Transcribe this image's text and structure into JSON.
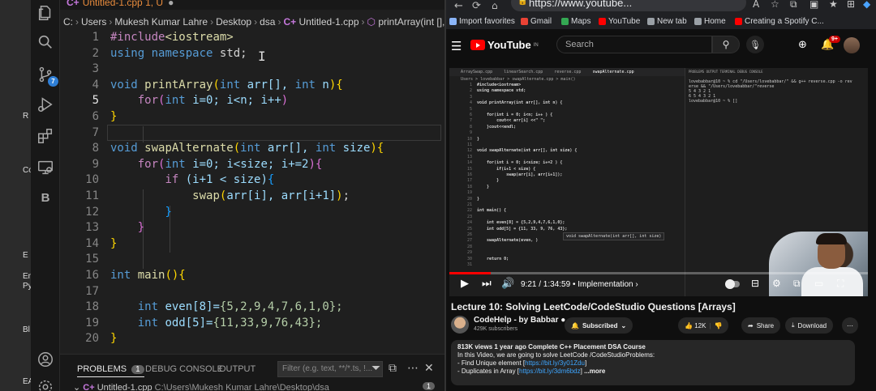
{
  "desktop_fragments": [
    "R",
    "Co",
    "E",
    "Em",
    "Py",
    "Bl",
    "EA"
  ],
  "vscode": {
    "tab_title": "Untitled-1.cpp",
    "tab_status": "1, U",
    "breadcrumb": [
      "C:",
      "Users",
      "Mukesh Kumar Lahre",
      "Desktop",
      "dsa",
      "Untitled-1.cpp",
      "printArray(int [], int)"
    ],
    "activity_badges": {
      "source_control": "7"
    },
    "line_numbers": [
      "1",
      "2",
      "3",
      "4",
      "5",
      "6",
      "7",
      "8",
      "9",
      "10",
      "11",
      "12",
      "13",
      "14",
      "15",
      "16",
      "17",
      "18",
      "19",
      "20"
    ],
    "active_line": "5",
    "code": {
      "l1_include": "#include",
      "l1_header": "<iostream>",
      "l2_using": "using",
      "l2_namespace": "namespace",
      "l2_std": "std;",
      "void": "void",
      "int": "int",
      "for": "for",
      "if": "if",
      "l4_fn": "printArray",
      "l4_params": "arr[], ",
      "l4_n": "n",
      "l5_body": "i=0; i<n; i++",
      "l8_fn": "swapAlternate",
      "l8_arr": "arr[], ",
      "l8_size": "size",
      "l9_body": "i=0; i<size; i+=2",
      "l10_cond": "(i+1 < size)",
      "l11_call": "swap",
      "l11_args": "arr[i], arr[i+1]",
      "l16_fn": "main",
      "l18_decl": "even[8]=",
      "l18_vals": "{5,2,9,4,7,6,1,0};",
      "l19_decl": "odd[5]=",
      "l19_vals": "{11,33,9,76,43};"
    },
    "panel": {
      "tabs": [
        "PROBLEMS",
        "DEBUG CONSOLE",
        "OUTPUT"
      ],
      "problems_count": "1",
      "filter_placeholder": "Filter (e.g. text, **/*.ts, !...",
      "file_label": "Untitled-1.cpp",
      "file_path": "C:\\Users\\Mukesh Kumar Lahre\\Desktop\\dsa",
      "file_count": "1"
    }
  },
  "browser": {
    "url": "https://www.youtube...",
    "bookmarks": [
      {
        "label": "Import favorites",
        "color": "#8ab4f8"
      },
      {
        "label": "Gmail",
        "color": "#ea4335"
      },
      {
        "label": "Maps",
        "color": "#34a853"
      },
      {
        "label": "YouTube",
        "color": "#ff0000"
      },
      {
        "label": "New tab",
        "color": "#9aa0a6"
      },
      {
        "label": "Home",
        "color": "#9aa0a6"
      },
      {
        "label": "Creating a Spotify C...",
        "color": "#ff0000"
      }
    ],
    "youtube": {
      "logo_text": "YouTube",
      "logo_region": "IN",
      "search_placeholder": "Search",
      "notification_count": "9+",
      "player": {
        "time": "9:21 / 1:34:59",
        "chapter": "Implementation",
        "progress": 0.098,
        "inner_tabs": [
          "ArraySwap.cpp",
          "linearSearch.cpp",
          "reverse.cpp",
          "swapAlternate.cpp"
        ],
        "inner_crumb": "Users > lovebabbar > swapAlternate.cpp > main()",
        "inner_line_numbers": [
          "1",
          "2",
          "3",
          "4",
          "5",
          "6",
          "7",
          "8",
          "9",
          "10",
          "11",
          "12",
          "13",
          "14",
          "15",
          "16",
          "17",
          "18",
          "19",
          "20",
          "21",
          "22",
          "23",
          "24",
          "25",
          "26",
          "27",
          "28",
          "29",
          "30",
          "31"
        ],
        "inner_code": [
          "#include<iostream>",
          "using namespace std;",
          "",
          "void printArray(int arr[], int n) {",
          "",
          "    for(int i = 0; i<n; i++ ) {",
          "        cout<< arr[i] <<\" \";",
          "    }cout<<endl;",
          "",
          "}",
          "",
          "void swapAlternate(int arr[], int size) {",
          "",
          "    for(int i = 0; i<size; i+=2 ) {",
          "        if(i+1 < size) {",
          "            swap(arr[i], arr[i+1]);",
          "        }",
          "    }",
          "",
          "}",
          "",
          "int main() {",
          "",
          "    int even[8] = {5,2,9,4,7,6,1,0};",
          "    int odd[5] = {11, 33, 9, 76, 43};",
          "",
          "    swapAlternate(even, )",
          "",
          "",
          "    return 0;",
          ""
        ],
        "inner_terminal_head": "PROBLEMS   OUTPUT   TERMINAL   DEBUG CONSOLE",
        "inner_terminal": [
          "lovebabbar@10 ~ % cd \"/Users/lovebabbar/\" && g++ reverse.cpp -o rev",
          "erse && \"/Users/lovebabbar/\"reverse",
          "5 4 3 2 1",
          "6 5 4 3 2 1",
          "lovebabbar@10 ~ % []"
        ],
        "inner_hint": "void swapAlternate(int arr[], int size)"
      },
      "video_title": "Lecture 10: Solving LeetCode/CodeStudio Questions [Arrays]",
      "channel_name": "CodeHelp - by Babbar",
      "channel_subs": "429K subscribers",
      "subscribe_label": "Subscribed",
      "likes": "12K",
      "share_label": "Share",
      "download_label": "Download",
      "description": {
        "stats": "813K views  1 year ago  Complete C++ Placement DSA Course",
        "line1": "In this Video, we are going to solve LeetCode /CodeStudioProblems:",
        "line2_text": "- Find Unique element [",
        "line2_link": "https://bit.ly/3y01Zdu",
        "line2_end": "]",
        "line3_text": "- Duplicates in Array [",
        "line3_link": "https://bit.ly/3dm6bdz",
        "line3_end": "]",
        "more": "...more"
      }
    }
  }
}
